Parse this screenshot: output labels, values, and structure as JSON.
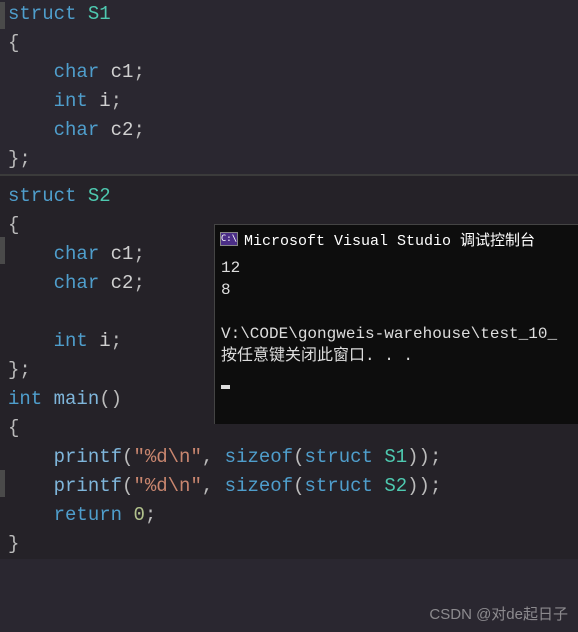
{
  "struct1": {
    "kw_struct": "struct",
    "name": "S1",
    "brace_open": "{",
    "members": {
      "m1": {
        "type": "char",
        "name": "c1",
        "semi": ";"
      },
      "m2": {
        "type": "int",
        "name": "i",
        "semi": ";"
      },
      "m3": {
        "type": "char",
        "name": "c2",
        "semi": ";"
      }
    },
    "brace_close": "};"
  },
  "struct2": {
    "kw_struct": "struct",
    "name": "S2",
    "brace_open": "{",
    "members": {
      "m1": {
        "type": "char",
        "name": "c1",
        "semi": ";"
      },
      "m2": {
        "type": "char",
        "name": "c2",
        "semi": ";"
      },
      "m3": {
        "type": "int",
        "name": "i",
        "semi": ";"
      }
    },
    "brace_close": "};"
  },
  "main": {
    "ret_type": "int",
    "name": "main",
    "parens": "()",
    "brace_open": "{",
    "line1": {
      "func": "printf",
      "open": "(",
      "str": "\"%d\\n\"",
      "comma": ", ",
      "sizeof": "sizeof",
      "p1": "(",
      "struct": "struct",
      "sname": "S1",
      "close": "));"
    },
    "line2": {
      "func": "printf",
      "open": "(",
      "str": "\"%d\\n\"",
      "comma": ", ",
      "sizeof": "sizeof",
      "p1": "(",
      "struct": "struct",
      "sname": "S2",
      "close": "));"
    },
    "ret": {
      "kw": "return",
      "val": "0",
      "semi": ";"
    },
    "brace_close": "}"
  },
  "console": {
    "icon": "C:\\",
    "title": "Microsoft Visual Studio 调试控制台",
    "out1": "12",
    "out2": "8",
    "blank": "",
    "path": "V:\\CODE\\gongweis-warehouse\\test_10_",
    "prompt": "按任意键关闭此窗口. . ."
  },
  "watermark": "CSDN @对de起日子"
}
